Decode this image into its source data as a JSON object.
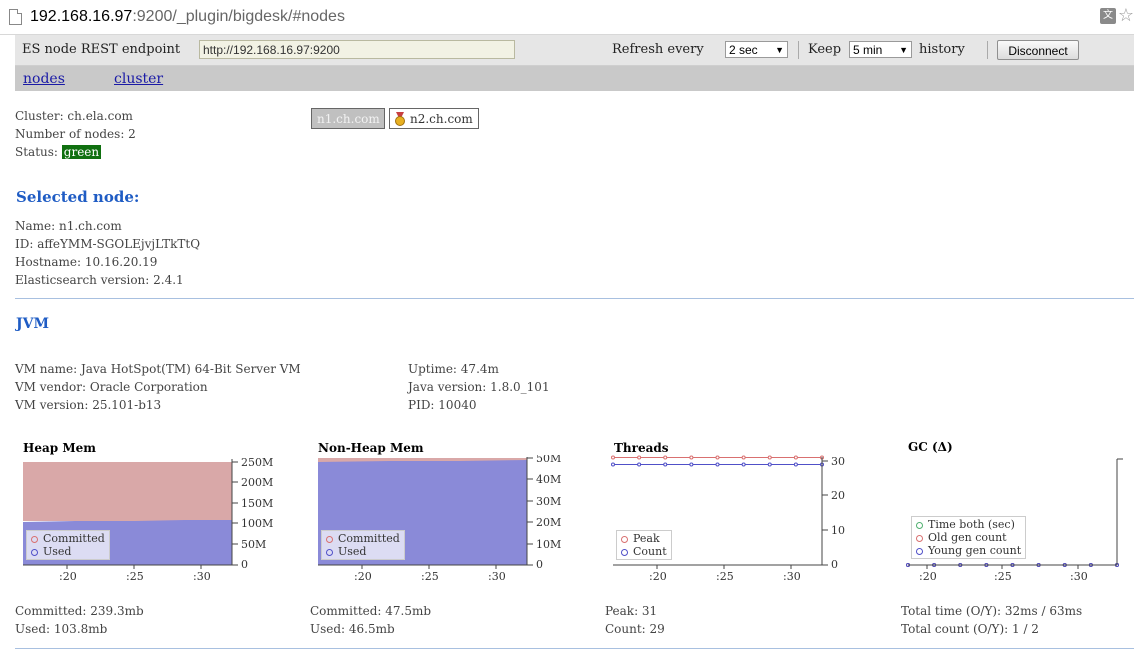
{
  "browser": {
    "url_host": "192.168.16.97",
    "url_rest": ":9200/_plugin/bigdesk/#nodes"
  },
  "toolbar": {
    "endpoint_label": "ES node REST endpoint",
    "endpoint_value": "http://192.168.16.97:9200",
    "refresh_label": "Refresh every",
    "refresh_value": "2 sec",
    "keep_label": "Keep",
    "keep_value": "5 min",
    "history_label": "history",
    "disconnect_label": "Disconnect"
  },
  "nav": {
    "nodes": "nodes",
    "cluster": "cluster"
  },
  "cluster": {
    "cluster_line": "Cluster: ch.ela.com",
    "nodes_line": "Number of nodes: 2",
    "status_label": "Status:",
    "status_value": "green",
    "node_buttons": [
      "n1.ch.com",
      "n2.ch.com"
    ]
  },
  "selected": {
    "heading": "Selected node:",
    "name": "Name: n1.ch.com",
    "id": "ID: affeYMM-SGOLEjvjLTkTtQ",
    "hostname": "Hostname: 10.16.20.19",
    "version": "Elasticsearch version: 2.4.1"
  },
  "jvm": {
    "heading": "JVM",
    "vm_name": "VM name: Java HotSpot(TM) 64-Bit Server VM",
    "vm_vendor": "VM vendor: Oracle Corporation",
    "vm_version": "VM version: 25.101-b13",
    "uptime": "Uptime: 47.4m",
    "java_version": "Java version: 1.8.0_101",
    "pid": "PID: 10040"
  },
  "colors": {
    "committed_fill": "#d9a8a8",
    "used_fill": "#8a8ad8",
    "peak": "#d97070",
    "count": "#5050c8",
    "gc_time": "#50b070"
  },
  "charts": [
    {
      "title": "Heap Mem",
      "legend": [
        "Committed",
        "Used"
      ],
      "stats": [
        "Committed: 239.3mb",
        "Used: 103.8mb"
      ]
    },
    {
      "title": "Non-Heap Mem",
      "legend": [
        "Committed",
        "Used"
      ],
      "stats": [
        "Committed: 47.5mb",
        "Used: 46.5mb"
      ]
    },
    {
      "title": "Threads",
      "legend": [
        "Peak",
        "Count"
      ],
      "stats": [
        "Peak: 31",
        "Count: 29"
      ]
    },
    {
      "title": "GC (Δ)",
      "legend": [
        "Time both (sec)",
        "Old gen count",
        "Young gen count"
      ],
      "stats": [
        "Total time (O/Y): 32ms / 63ms",
        "Total count (O/Y): 1 / 2"
      ]
    }
  ],
  "chart_data": [
    {
      "type": "area",
      "title": "Heap Mem",
      "x": [
        ":20",
        ":25",
        ":30"
      ],
      "y_ticks": [
        "0",
        "50M",
        "100M",
        "150M",
        "200M",
        "250M"
      ],
      "ylim": [
        0,
        250
      ],
      "series": [
        {
          "name": "Committed",
          "values": [
            239.3,
            239.3,
            239.3,
            239.3,
            239.3
          ]
        },
        {
          "name": "Used",
          "values": [
            101,
            102,
            103,
            103.5,
            103.8
          ]
        }
      ]
    },
    {
      "type": "area",
      "title": "Non-Heap Mem",
      "x": [
        ":20",
        ":25",
        ":30"
      ],
      "y_ticks": [
        "0",
        "10M",
        "20M",
        "30M",
        "40M",
        "50M"
      ],
      "ylim": [
        0,
        50
      ],
      "series": [
        {
          "name": "Committed",
          "values": [
            47.5,
            47.5,
            47.5,
            47.5,
            47.5
          ]
        },
        {
          "name": "Used",
          "values": [
            46.0,
            46.2,
            46.3,
            46.4,
            46.5
          ]
        }
      ]
    },
    {
      "type": "line",
      "title": "Threads",
      "x": [
        ":20",
        ":25",
        ":30"
      ],
      "y_ticks": [
        "0",
        "10",
        "20",
        "30"
      ],
      "ylim": [
        0,
        30
      ],
      "series": [
        {
          "name": "Peak",
          "values": [
            31,
            31,
            31,
            31,
            31,
            31,
            31,
            31,
            31
          ]
        },
        {
          "name": "Count",
          "values": [
            29,
            29,
            29,
            29,
            29,
            29,
            29,
            29,
            29
          ]
        }
      ]
    },
    {
      "type": "line",
      "title": "GC (Δ)",
      "x": [
        ":20",
        ":25",
        ":30"
      ],
      "series": [
        {
          "name": "Time both (sec)",
          "values": [
            0,
            0,
            0,
            0,
            0,
            0,
            0,
            0,
            0
          ]
        },
        {
          "name": "Old gen count",
          "values": [
            0,
            0,
            0,
            0,
            0,
            0,
            0,
            0,
            0
          ]
        },
        {
          "name": "Young gen count",
          "values": [
            0,
            0,
            0,
            0,
            0,
            0,
            0,
            0,
            0
          ]
        }
      ]
    }
  ]
}
